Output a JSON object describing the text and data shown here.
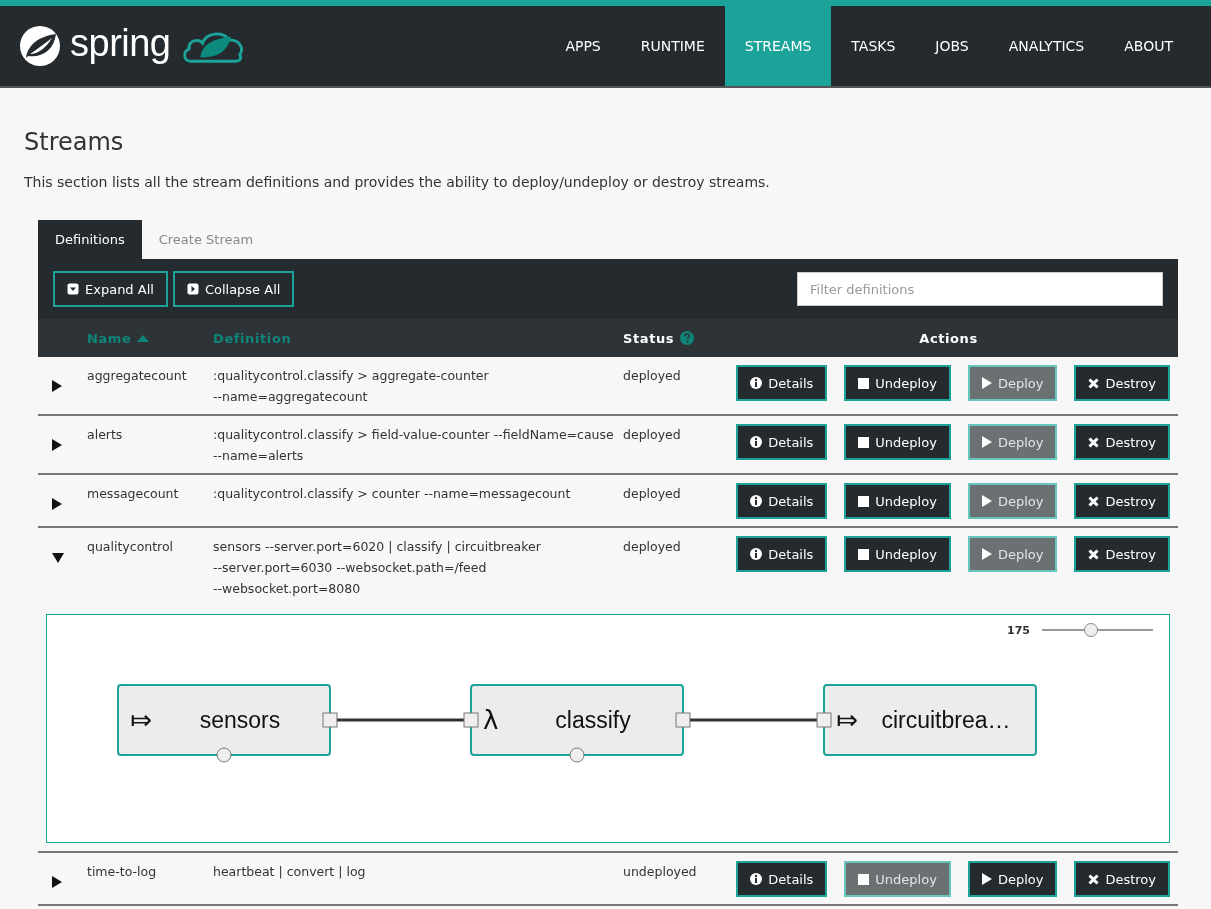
{
  "brand": {
    "name": "spring"
  },
  "nav": {
    "items": [
      {
        "label": "APPS",
        "selected": false
      },
      {
        "label": "RUNTIME",
        "selected": false
      },
      {
        "label": "STREAMS",
        "selected": true
      },
      {
        "label": "TASKS",
        "selected": false
      },
      {
        "label": "JOBS",
        "selected": false
      },
      {
        "label": "ANALYTICS",
        "selected": false
      },
      {
        "label": "ABOUT",
        "selected": false
      }
    ]
  },
  "page": {
    "title": "Streams",
    "description": "This section lists all the stream definitions and provides the ability to deploy/undeploy or destroy streams."
  },
  "tabs": [
    {
      "label": "Definitions",
      "selected": true
    },
    {
      "label": "Create Stream",
      "selected": false
    }
  ],
  "toolbar": {
    "buttons": [
      {
        "kind": "expand",
        "label": "Expand All"
      },
      {
        "kind": "collapse",
        "label": "Collapse All"
      }
    ],
    "filter": {
      "placeholder": "Filter definitions"
    }
  },
  "table": {
    "columns": [
      {
        "label": "Name",
        "sortable": true,
        "sorted": true,
        "help": false
      },
      {
        "label": "Definition",
        "sortable": true,
        "sorted": false,
        "help": false
      },
      {
        "label": "Status",
        "sortable": false,
        "sorted": false,
        "help": true
      },
      {
        "label": "Actions",
        "sortable": false,
        "sorted": false,
        "help": false
      }
    ],
    "rows": [
      {
        "name": "aggregatecount",
        "definition": ":qualitycontrol.classify > aggregate-counter --name=aggregatecount",
        "status": "deployed",
        "expanded": false,
        "actions": [
          {
            "kind": "details",
            "label": "Details",
            "disabled": false
          },
          {
            "kind": "undeploy",
            "label": "Undeploy",
            "disabled": false
          },
          {
            "kind": "deploy",
            "label": "Deploy",
            "disabled": true
          },
          {
            "kind": "destroy",
            "label": "Destroy",
            "disabled": false
          }
        ]
      },
      {
        "name": "alerts",
        "definition": ":qualitycontrol.classify > field-value-counter --fieldName=cause --name=alerts",
        "status": "deployed",
        "expanded": false,
        "actions": [
          {
            "kind": "details",
            "label": "Details",
            "disabled": false
          },
          {
            "kind": "undeploy",
            "label": "Undeploy",
            "disabled": false
          },
          {
            "kind": "deploy",
            "label": "Deploy",
            "disabled": true
          },
          {
            "kind": "destroy",
            "label": "Destroy",
            "disabled": false
          }
        ]
      },
      {
        "name": "messagecount",
        "definition": ":qualitycontrol.classify > counter --name=messagecount",
        "status": "deployed",
        "expanded": false,
        "actions": [
          {
            "kind": "details",
            "label": "Details",
            "disabled": false
          },
          {
            "kind": "undeploy",
            "label": "Undeploy",
            "disabled": false
          },
          {
            "kind": "deploy",
            "label": "Deploy",
            "disabled": true
          },
          {
            "kind": "destroy",
            "label": "Destroy",
            "disabled": false
          }
        ]
      },
      {
        "name": "qualitycontrol",
        "definition": "sensors --server.port=6020 | classify | circuitbreaker --server.port=6030 --websocket.path=/feed --websocket.port=8080",
        "status": "deployed",
        "expanded": true,
        "actions": [
          {
            "kind": "details",
            "label": "Details",
            "disabled": false
          },
          {
            "kind": "undeploy",
            "label": "Undeploy",
            "disabled": false
          },
          {
            "kind": "deploy",
            "label": "Deploy",
            "disabled": true
          },
          {
            "kind": "destroy",
            "label": "Destroy",
            "disabled": false
          }
        ],
        "graph": {
          "zoom": "175",
          "level": 0.44,
          "nodes": [
            {
              "kind": "source",
              "symbol": "⤇",
              "label": "sensors"
            },
            {
              "kind": "processor",
              "symbol": "λ",
              "label": "classify"
            },
            {
              "kind": "sink",
              "symbol": "⤇",
              "label": "circuitbrea…"
            }
          ]
        }
      },
      {
        "name": "time-to-log",
        "definition": "heartbeat | convert | log",
        "status": "undeployed",
        "expanded": false,
        "actions": [
          {
            "kind": "details",
            "label": "Details",
            "disabled": false
          },
          {
            "kind": "undeploy",
            "label": "Undeploy",
            "disabled": true
          },
          {
            "kind": "deploy",
            "label": "Deploy",
            "disabled": false
          },
          {
            "kind": "destroy",
            "label": "Destroy",
            "disabled": false
          }
        ]
      }
    ]
  }
}
